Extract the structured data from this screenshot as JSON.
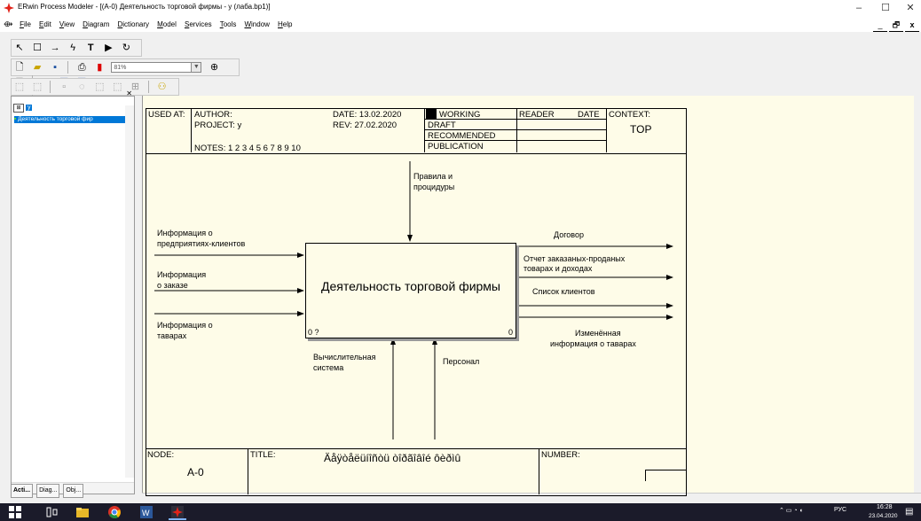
{
  "window": {
    "title": "ERwin Process Modeler - [(A-0) Деятельность торговой фирмы - y  (лаба.bp1)]",
    "min": "–",
    "max": "☐",
    "close": "✕"
  },
  "menu": [
    "File",
    "Edit",
    "View",
    "Diagram",
    "Dictionary",
    "Model",
    "Services",
    "Tools",
    "Window",
    "Help"
  ],
  "mdi": {
    "min": "_",
    "restore": "🗗",
    "close": "x"
  },
  "toolbar": {
    "zoom_value": "81%"
  },
  "left_panel": {
    "root": "y",
    "child": "Деятельность торговой фир",
    "tabs": [
      "Acti...",
      "Diag...",
      "Obj..."
    ]
  },
  "diagram": {
    "header": {
      "used_at": "USED AT:",
      "author": "AUTHOR:",
      "project": "PROJECT:  y",
      "notes": "NOTES:  1  2  3  4  5  6  7  8  9  10",
      "date": "DATE:  13.02.2020",
      "rev": "REV:   27.02.2020",
      "working": "WORKING",
      "draft": "DRAFT",
      "recommended": "RECOMMENDED",
      "publication": "PUBLICATION",
      "reader": "READER",
      "date2": "DATE",
      "context": "CONTEXT:",
      "context_value": "TOP"
    },
    "box": {
      "title": "Деятельность торговой фирмы",
      "corner_left": "0 ?",
      "corner_right": "0"
    },
    "controls": [
      "Правила и",
      "процидуры"
    ],
    "inputs": [
      [
        "Информация о",
        "предприятиях-клиентов"
      ],
      [
        "Информация",
        "о заказе"
      ],
      [
        "Информация о",
        "таварах"
      ]
    ],
    "outputs": {
      "contract": "Договор",
      "report": [
        "Отчет заказаных-проданых",
        "товарах и доходах"
      ],
      "clients": "Список клиентов",
      "changed": [
        "Изменённая",
        "информация о таварах"
      ]
    },
    "mechanisms": {
      "system": [
        "Вычислительная",
        "система"
      ],
      "staff": "Персонал"
    },
    "footer": {
      "node": "NODE:",
      "node_value": "A-0",
      "title": "TITLE:",
      "title_value": "Äåÿòåëüíîñòü òîðãîâîé ôèðìû",
      "number": "NUMBER:"
    }
  },
  "taskbar": {
    "lang": "РУС",
    "time": "16:28",
    "date": "23.04.2020"
  },
  "colors": {
    "canvas": "#fefce8",
    "selection": "#0078d7",
    "taskbar": "#1b1b2a"
  }
}
